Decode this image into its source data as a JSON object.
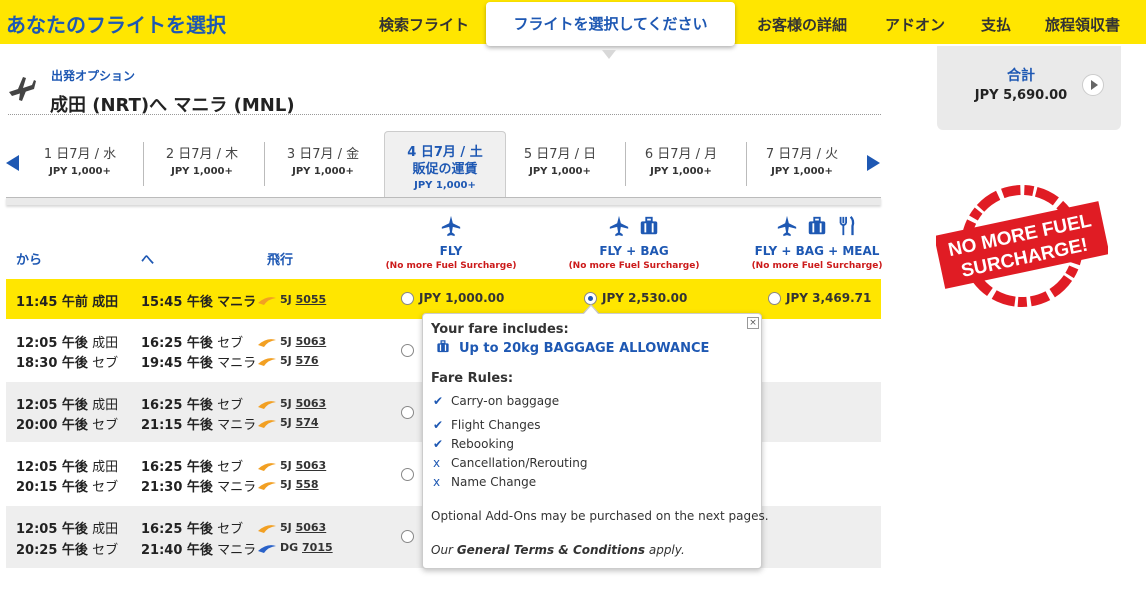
{
  "header": {
    "title": "あなたのフライトを選択",
    "nav": [
      "検索フライト",
      "フライトを選択してください",
      "お客様の詳細",
      "アドオン",
      "支払",
      "旅程領収書"
    ]
  },
  "departure": {
    "label": "出発オプション",
    "route": "成田 (NRT)へ マニラ (MNL)"
  },
  "total": {
    "label": "合計",
    "amount": "JPY 5,690.00"
  },
  "dates": [
    {
      "date": "1 日7月 / 水",
      "price": "JPY 1,000+"
    },
    {
      "date": "2 日7月 / 木",
      "price": "JPY 1,000+"
    },
    {
      "date": "3 日7月 / 金",
      "price": "JPY 1,000+"
    },
    {
      "date": "4 日7月 / 土",
      "promo": "販促の運賃",
      "price": "JPY 1,000+"
    },
    {
      "date": "5 日7月 / 日",
      "price": "JPY 1,000+"
    },
    {
      "date": "6 日7月 / 月",
      "price": "JPY 1,000+"
    },
    {
      "date": "7 日7月 / 火",
      "price": "JPY 1,000+"
    }
  ],
  "columns": {
    "from": "から",
    "to": "へ",
    "flight": "飛行"
  },
  "fares": [
    {
      "name": "FLY",
      "note": "(No more Fuel Surcharge)"
    },
    {
      "name": "FLY + BAG",
      "note": "(No more Fuel Surcharge)"
    },
    {
      "name": "FLY + BAG + MEAL",
      "note": "(No more Fuel Surcharge)"
    }
  ],
  "rows": [
    {
      "legs": [
        {
          "dep": "11:45 午前",
          "from": "成田",
          "arr": "15:45 午後",
          "to": "マニラ",
          "code": "5J",
          "num": "5055"
        }
      ],
      "prices": [
        "JPY 1,000.00",
        "JPY 2,530.00",
        "JPY 3,469.71"
      ]
    },
    {
      "legs": [
        {
          "dep": "12:05 午後",
          "from": "成田",
          "arr": "16:25 午後",
          "to": "セブ",
          "code": "5J",
          "num": "5063"
        },
        {
          "dep": "18:30 午後",
          "from": "セブ",
          "arr": "19:45 午後",
          "to": "マニラ",
          "code": "5J",
          "num": "576"
        }
      ]
    },
    {
      "legs": [
        {
          "dep": "12:05 午後",
          "from": "成田",
          "arr": "16:25 午後",
          "to": "セブ",
          "code": "5J",
          "num": "5063"
        },
        {
          "dep": "20:00 午後",
          "from": "セブ",
          "arr": "21:15 午後",
          "to": "マニラ",
          "code": "5J",
          "num": "574"
        }
      ]
    },
    {
      "legs": [
        {
          "dep": "12:05 午後",
          "from": "成田",
          "arr": "16:25 午後",
          "to": "セブ",
          "code": "5J",
          "num": "5063"
        },
        {
          "dep": "20:15 午後",
          "from": "セブ",
          "arr": "21:30 午後",
          "to": "マニラ",
          "code": "5J",
          "num": "558"
        }
      ]
    },
    {
      "legs": [
        {
          "dep": "12:05 午後",
          "from": "成田",
          "arr": "16:25 午後",
          "to": "セブ",
          "code": "5J",
          "num": "5063"
        },
        {
          "dep": "20:25 午後",
          "from": "セブ",
          "arr": "21:40 午後",
          "to": "マニラ",
          "code": "DG",
          "num": "7015"
        }
      ]
    }
  ],
  "popup": {
    "includes_title": "Your fare includes:",
    "baggage": "Up to 20kg BAGGAGE ALLOWANCE",
    "rules_title": "Fare Rules:",
    "rules": [
      {
        "mark": "✔",
        "text": "Carry-on baggage"
      },
      {
        "mark": "✔",
        "text": "Flight Changes"
      },
      {
        "mark": "✔",
        "text": "Rebooking"
      },
      {
        "mark": "x",
        "text": "Cancellation/Rerouting"
      },
      {
        "mark": "x",
        "text": "Name Change"
      }
    ],
    "addons": "Optional Add-Ons may be purchased on the next pages.",
    "terms_prefix": "Our ",
    "terms_link": "General Terms & Conditions",
    "terms_suffix": " apply.",
    "close": "×"
  },
  "stamp": {
    "line1": "NO MORE FUEL",
    "line2": "SURCHARGE!"
  },
  "colors": {
    "brand_yellow": "#ffe600",
    "brand_blue": "#1e58b3",
    "surcharge_red": "#cc1a1a",
    "stamp_red": "#e01c24"
  },
  "icons": [
    "plane-icon",
    "baggage-icon",
    "meal-icon",
    "wing-icon",
    "chevron-left-icon",
    "chevron-right-icon",
    "play-icon",
    "close-icon"
  ]
}
